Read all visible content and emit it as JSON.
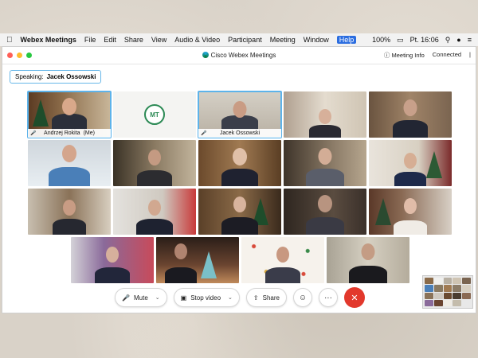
{
  "menubar": {
    "app_name": "Webex Meetings",
    "items": [
      "File",
      "Edit",
      "Share",
      "View",
      "Audio & Video",
      "Participant",
      "Meeting",
      "Window",
      "Help"
    ],
    "battery": "100%",
    "clock": "Pt. 16:06"
  },
  "window": {
    "title": "Cisco Webex Meetings",
    "meeting_info": "Meeting Info",
    "status": "Connected"
  },
  "speaking": {
    "label": "Speaking:",
    "name": "Jacek Ossowski"
  },
  "participants": [
    {
      "name": "Andrzej Rokita",
      "suffix": "(Me)"
    },
    {
      "name": "Jacek Ossowski"
    }
  ],
  "controls": {
    "mute": "Mute",
    "stop_video": "Stop video",
    "share": "Share"
  },
  "colors": {
    "accent": "#5db3ea",
    "leave": "#e2382c",
    "menu_highlight": "#2b6de0"
  },
  "icons": {
    "mute": "microphone-icon",
    "video": "camera-icon",
    "share": "share-icon",
    "reactions": "smiley-icon",
    "more": "more-icon",
    "leave": "close-icon"
  }
}
